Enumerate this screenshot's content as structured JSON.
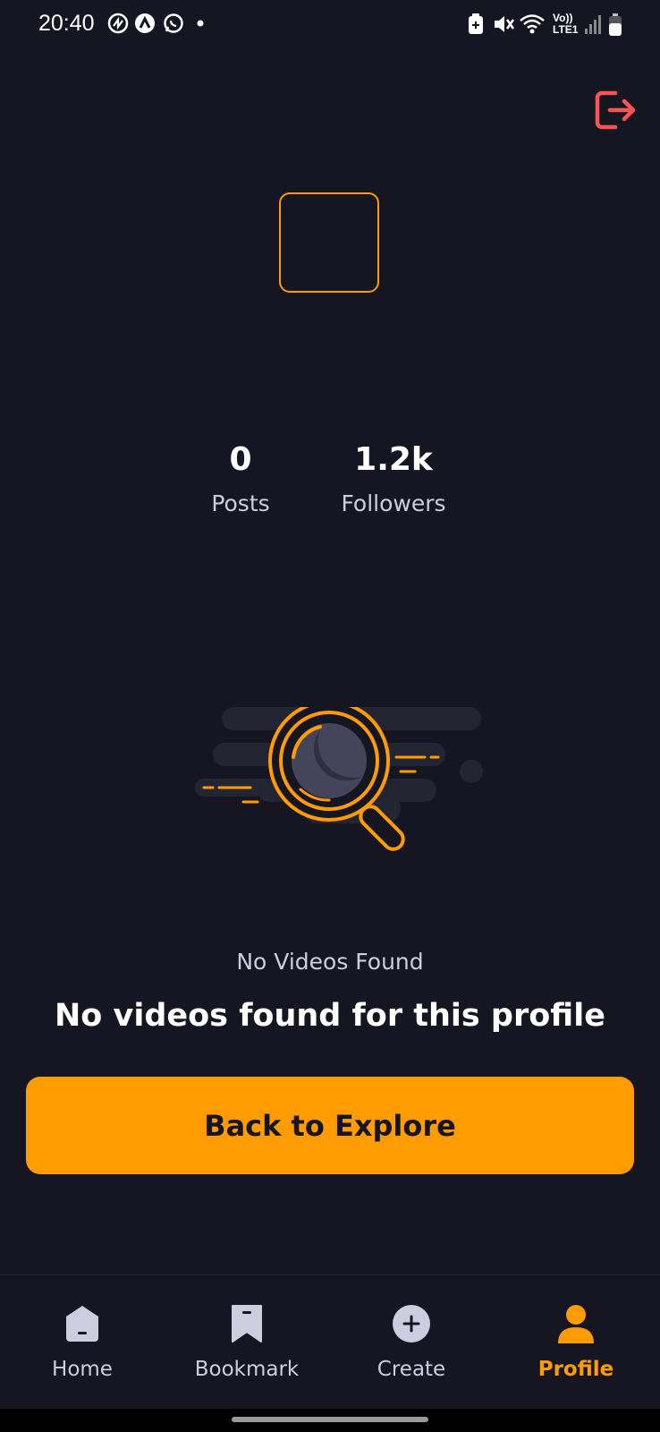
{
  "status_bar": {
    "time": "20:40",
    "network_label": "Vo)) LTE1",
    "icons": [
      "notification-icon",
      "app-icon",
      "whatsapp-icon",
      "dot-icon",
      "battery-saver-icon",
      "mute-icon",
      "wifi-icon",
      "signal-icon",
      "battery-icon"
    ]
  },
  "header": {
    "logout_icon": "logout-icon",
    "logout_color": "#F75555"
  },
  "profile": {
    "avatar_border_color": "#FF9C01",
    "stats": [
      {
        "value": "0",
        "label": "Posts"
      },
      {
        "value": "1.2k",
        "label": "Followers"
      }
    ]
  },
  "empty_state": {
    "icon": "magnifier-empty-icon",
    "title": "No Videos Found",
    "subtitle": "No videos found for this profile",
    "button_label": "Back to Explore"
  },
  "tabs": [
    {
      "label": "Home",
      "icon": "home-icon",
      "active": false
    },
    {
      "label": "Bookmark",
      "icon": "bookmark-icon",
      "active": false
    },
    {
      "label": "Create",
      "icon": "plus-icon",
      "active": false
    },
    {
      "label": "Profile",
      "icon": "profile-icon",
      "active": true
    }
  ],
  "colors": {
    "background": "#161622",
    "accent": "#FF9C01",
    "muted_text": "#CDCDE0"
  }
}
